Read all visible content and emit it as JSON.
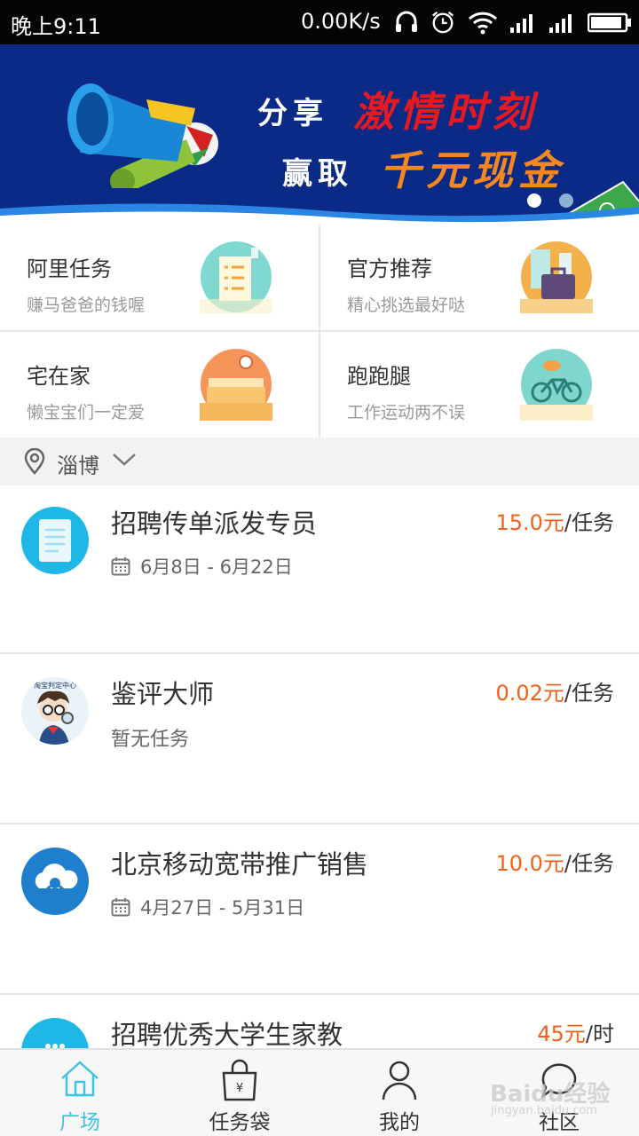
{
  "status_bar": {
    "time": "晚上9:11",
    "network_speed": "0.00K/s",
    "icons": [
      "headset-icon",
      "alarm-icon",
      "wifi-icon",
      "signal-icon",
      "signal-icon",
      "battery-icon"
    ]
  },
  "banner": {
    "line1_white": "分享",
    "line1_red": "激情时刻",
    "line2_white": "赢取",
    "line2_orange": "千元现金",
    "active_page": 1,
    "page_count": 2
  },
  "categories": [
    {
      "title": "阿里任务",
      "subtitle": "赚马爸爸的钱喔",
      "icon": "task-list-icon"
    },
    {
      "title": "官方推荐",
      "subtitle": "精心挑选最好哒",
      "icon": "briefcase-icon"
    },
    {
      "title": "宅在家",
      "subtitle": "懒宝宝们一定爱",
      "icon": "bed-icon"
    },
    {
      "title": "跑跑腿",
      "subtitle": "工作运动两不误",
      "icon": "bicycle-icon"
    }
  ],
  "location": {
    "city": "淄博"
  },
  "tasks": [
    {
      "name": "招聘传单派发专员",
      "price": "15.0元",
      "unit": "/任务",
      "dates": "6月8日 - 6月22日",
      "icon": "document-icon"
    },
    {
      "name": "鉴评大师",
      "price": "0.02元",
      "unit": "/任务",
      "status": "暂无任务",
      "icon": "cartoon-avatar-icon",
      "avatar_text": "淘宝判定中心"
    },
    {
      "name": "北京移动宽带推广销售",
      "price": "10.0元",
      "unit": "/任务",
      "dates": "4月27日 - 5月31日",
      "icon": "cloud-icon"
    },
    {
      "name": "招聘优秀大学生家教",
      "price": "45元",
      "unit": "/时",
      "icon": "tutor-icon"
    }
  ],
  "bottom_nav": [
    {
      "label": "广场",
      "icon": "home-icon",
      "active": true
    },
    {
      "label": "任务袋",
      "icon": "bag-icon",
      "active": false
    },
    {
      "label": "我的",
      "icon": "person-icon",
      "active": false
    },
    {
      "label": "社区",
      "icon": "chat-icon",
      "active": false
    }
  ],
  "watermark": {
    "text": "Baidu经验",
    "sub": "jingyan.baidu.com"
  },
  "colors": {
    "accent": "#3cc4e0",
    "price": "#f0621b",
    "banner_bg": "#0b2a85"
  }
}
